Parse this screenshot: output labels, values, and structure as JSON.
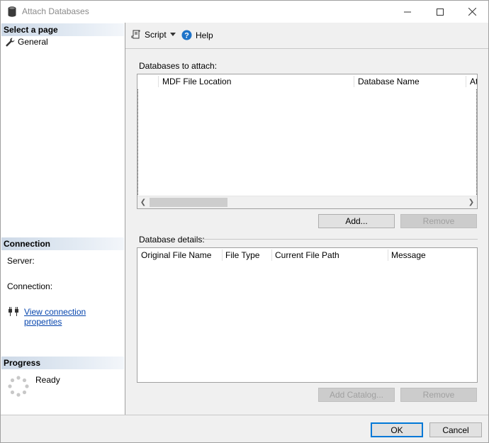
{
  "window": {
    "title": "Attach Databases"
  },
  "left": {
    "select_page": "Select a page",
    "pages": [
      {
        "label": "General"
      }
    ],
    "connection": {
      "header": "Connection",
      "server_label": "Server:",
      "connection_label": "Connection:",
      "view_link": "View connection properties"
    },
    "progress": {
      "header": "Progress",
      "status": "Ready"
    }
  },
  "toolbar": {
    "script_label": "Script",
    "help_label": "Help"
  },
  "attach": {
    "label": "Databases to attach:",
    "columns": [
      "MDF File Location",
      "Database Name",
      "At"
    ],
    "add_button": "Add...",
    "remove_button": "Remove"
  },
  "details": {
    "label": "Database details:",
    "columns": [
      "Original File Name",
      "File Type",
      "Current File Path",
      "Message"
    ],
    "add_catalog_button": "Add Catalog...",
    "remove_button": "Remove"
  },
  "footer": {
    "ok_label": "OK",
    "cancel_label": "Cancel"
  },
  "colors": {
    "link": "#0645ad",
    "header_gradient": "#cdd9e7",
    "help_icon": "#1e73c8",
    "focus": "#0078d7"
  }
}
